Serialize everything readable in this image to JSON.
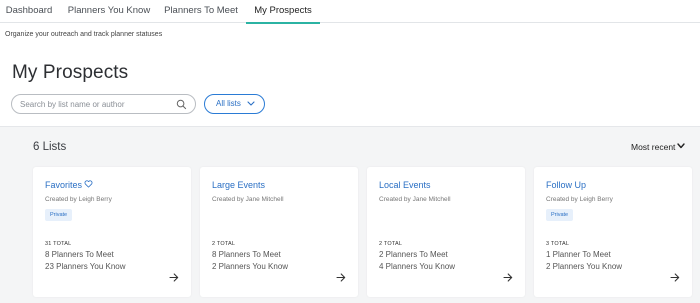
{
  "tabs": [
    {
      "label": "Dashboard"
    },
    {
      "label": "Planners You Know"
    },
    {
      "label": "Planners To Meet"
    },
    {
      "label": "My Prospects",
      "active": true
    }
  ],
  "subtitle": "Organize your outreach and track planner statuses",
  "page_title": "My Prospects",
  "search": {
    "placeholder": "Search by list name or author",
    "value": "",
    "icon": "search-icon"
  },
  "filter": {
    "label": "All lists",
    "icon": "chevron-down-icon"
  },
  "list_count": "6 Lists",
  "sort": {
    "label": "Most recent",
    "icon": "chevron-down-icon"
  },
  "cards": [
    {
      "name": "Favorites",
      "author": "Created by Leigh Berry",
      "badge": "Private",
      "total": "31 TOTAL",
      "line1": "8 Planners To Meet",
      "line2": "23 Planners You Know"
    },
    {
      "name": "Large Events",
      "author": "Created by Jane Mitchell",
      "badge": "",
      "total": "2 TOTAL",
      "line1": "8 Planners To Meet",
      "line2": "2 Planners You Know"
    },
    {
      "name": "Local Events",
      "author": "Created by Jane Mitchell",
      "badge": "",
      "total": "2 TOTAL",
      "line1": "2 Planners To Meet",
      "line2": "4 Planners You Know"
    },
    {
      "name": "Follow Up",
      "author": "Created by Leigh Berry",
      "badge": "Private",
      "total": "3 TOTAL",
      "line1": "1 Planner To Meet",
      "line2": "2 Planners You Know"
    }
  ],
  "colors": {
    "accent": "#2bb3a3",
    "link": "#2a6fc4",
    "badge_bg": "#e7f0fb",
    "panel_bg": "#f4f5f6"
  }
}
